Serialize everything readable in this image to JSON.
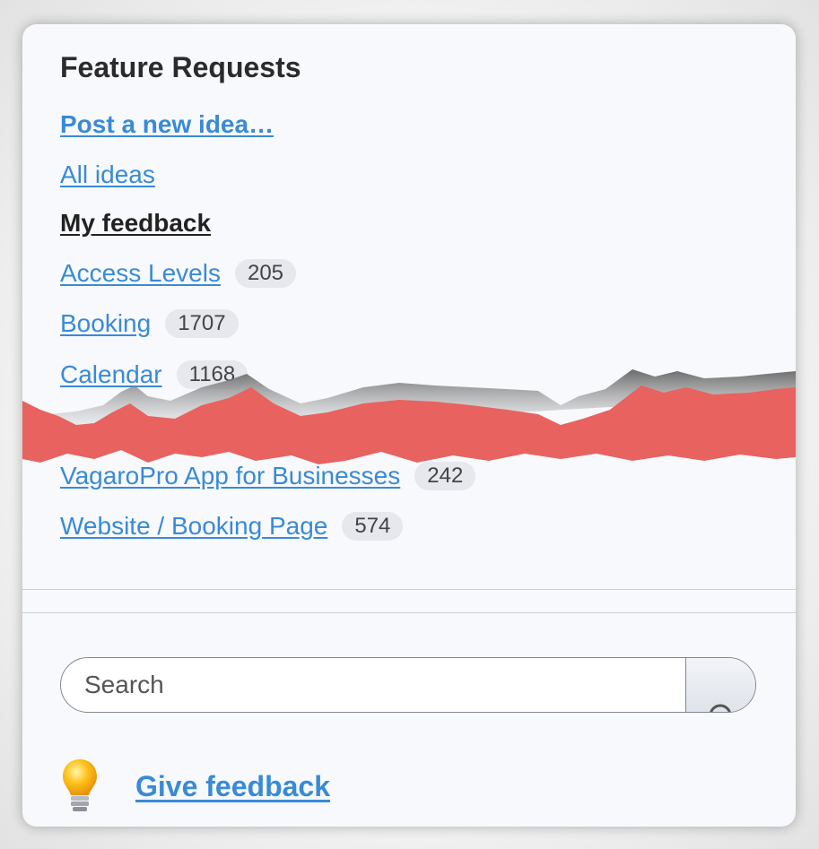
{
  "panel": {
    "title": "Feature Requests",
    "post_idea_label": "Post a new idea…",
    "all_ideas_label": "All ideas",
    "my_feedback_label": "My feedback"
  },
  "categories": [
    {
      "label": "Access Levels",
      "count": "205"
    },
    {
      "label": "Booking",
      "count": "1707"
    },
    {
      "label": "Calendar",
      "count": "1168"
    },
    {
      "label": "VagaroPro App for Businesses",
      "count": "242"
    },
    {
      "label": "Website / Booking Page",
      "count": "574"
    }
  ],
  "search": {
    "placeholder": "Search"
  },
  "give_feedback_label": "Give feedback",
  "icons": {
    "search_button": "search-icon",
    "feedback": "lightbulb-icon"
  },
  "colors": {
    "link": "#3a8ad6",
    "tear": "#e8625f",
    "card_bg": "#f7f9fd"
  }
}
